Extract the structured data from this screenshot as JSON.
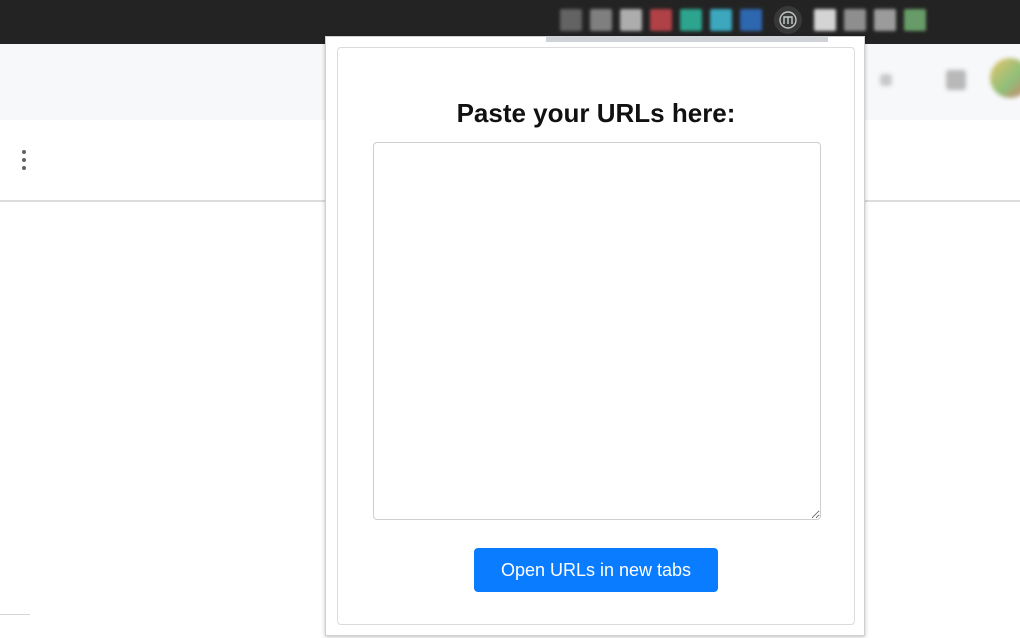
{
  "browser": {
    "extension_icons": [
      {
        "name": "extension-icon-1",
        "color": "#6a6a6a"
      },
      {
        "name": "extension-icon-2",
        "color": "#8a8a8a"
      },
      {
        "name": "extension-icon-3",
        "color": "#bdbdbd"
      },
      {
        "name": "extension-icon-4",
        "color": "#c0454a"
      },
      {
        "name": "extension-icon-5",
        "color": "#2fb39a"
      },
      {
        "name": "extension-icon-6",
        "color": "#3fb6d0"
      },
      {
        "name": "extension-icon-7",
        "color": "#2f6fbf"
      }
    ],
    "active_extension_icon": "url-opener-extension-icon",
    "right_icons": [
      {
        "name": "extension-icon-8",
        "color": "#e8e8e8"
      },
      {
        "name": "extension-icon-9",
        "color": "#9a9a9a"
      },
      {
        "name": "extension-icon-10",
        "color": "#a8a8a8"
      },
      {
        "name": "extension-icon-11",
        "color": "#6fa86f"
      }
    ]
  },
  "page": {
    "menu_icon": "kebab-menu-icon"
  },
  "popup": {
    "title": "Paste your URLs here:",
    "textarea_value": "",
    "textarea_placeholder": "",
    "button_label": "Open URLs in new tabs",
    "button_color": "#0a7cff"
  }
}
